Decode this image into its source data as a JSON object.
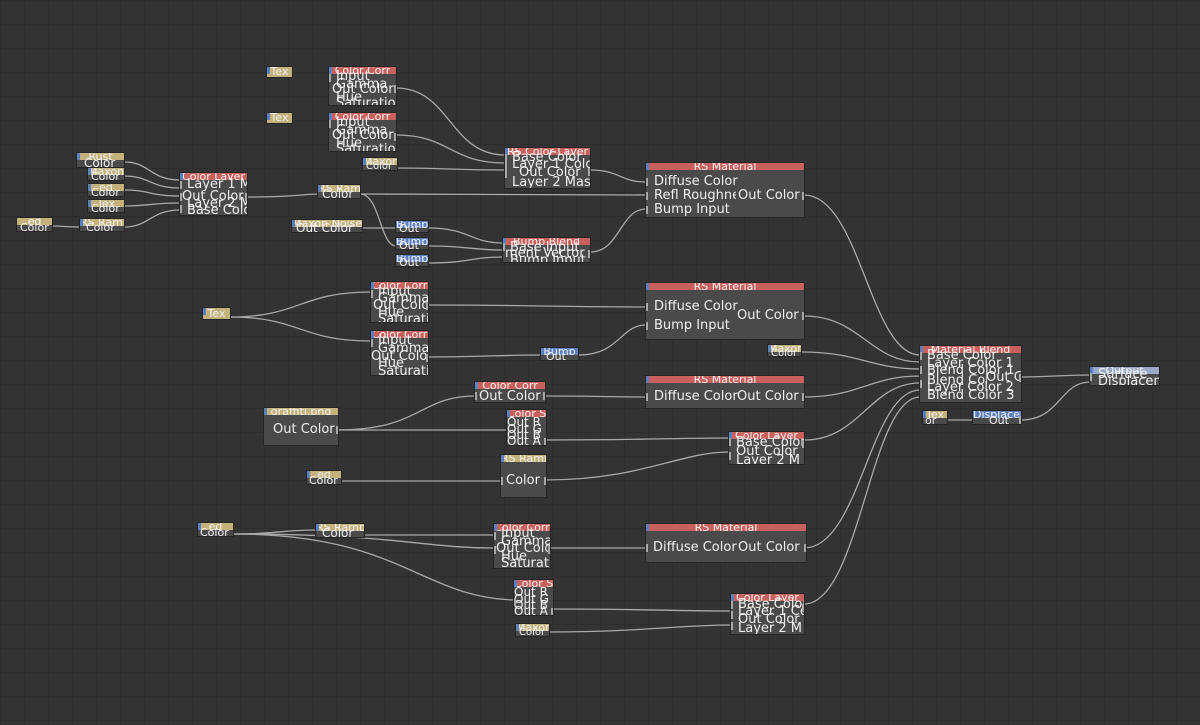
{
  "rs_material_1": {
    "title": "RS Material",
    "in1": "Diffuse Color",
    "in2": "Refl Roughness",
    "in3": "Bump Input",
    "out": "Out Color"
  },
  "rs_material_2": {
    "title": "RS Material",
    "in1": "Diffuse Color",
    "in2": "Bump Input",
    "out": "Out Color"
  },
  "rs_material_3": {
    "title": "RS Material",
    "in1": "Diffuse Color",
    "out": "Out Color"
  },
  "rs_material_4": {
    "title": "RS Material",
    "in1": "Diffuse Color",
    "out": "Out Color"
  },
  "material_blend": {
    "title": "Material Blend",
    "p1": "Base Color",
    "p2": "Layer Color 1",
    "p3": "Blend Color 1",
    "p4": "Blend Color 2",
    "p5": "Blend Color 3",
    "p6": "Layer Color 2",
    "p7": "Layer Color 3",
    "out": "Out Color"
  },
  "output": {
    "title": "Output",
    "p1": "Surface",
    "p2": "Displacement"
  },
  "cc1": {
    "title": "Color Corr",
    "p1": "Input",
    "p2": "Gamma",
    "p3": "Out Color",
    "p4": "Hue",
    "p5": "Saturation"
  },
  "cc2": {
    "title": "Color Corr",
    "p1": "Input",
    "p2": "Gamma",
    "p3": "Out Color",
    "p4": "Hue",
    "p5": "Saturation"
  },
  "cc3": {
    "title": "Color Corr",
    "p1": "Input",
    "p2": "Gamma",
    "p3": "Out Color",
    "p4": "Hue",
    "p5": "Saturation"
  },
  "cc4": {
    "title": "Color Corr",
    "p1": "Input",
    "p2": "Gamma",
    "p3": "Out Color",
    "p4": "Hue",
    "p5": "Saturation"
  },
  "cc5": {
    "title": "Color Corr",
    "p1": "Input",
    "p2": "Gamma",
    "p3": "Out Color",
    "p4": "Hue",
    "p5": "Saturation"
  },
  "cc6": {
    "title": "Color Corr",
    "p1": "Out Color"
  },
  "cl1": {
    "title": "RS Color Layer",
    "p1": "Base Color",
    "p2": "Layer 1 Color",
    "p3": "Out Color",
    "p4": "Layer 2 Mask"
  },
  "cl2": {
    "title": "Color Layer",
    "p1": "Layer 1 M",
    "p2": "Out Color",
    "p3": "Layer 2 M",
    "p4": "Base Color"
  },
  "cl3": {
    "title": "Color Layer",
    "p1": "Base Color",
    "p2": "Out Color",
    "p3": "Layer 2 M"
  },
  "cl4": {
    "title": "Color Layer",
    "p1": "Base Color",
    "p2": "Layer 1 Co",
    "p3": "Out Color",
    "p4": "Layer 2 M"
  },
  "bump_blend": {
    "title": "Bump Blend",
    "p1": "Base Input",
    "p2": "ment Vector",
    "p3": "Bump Input"
  },
  "bump1": {
    "title": "Bump",
    "out": "Out"
  },
  "bump2": {
    "title": "Bump",
    "out": "Out"
  },
  "bump3": {
    "title": "Bump",
    "out": "Out"
  },
  "bump4": {
    "title": "Bump",
    "out": "Out"
  },
  "ramp1": {
    "title": "RS Ramp",
    "out": "Color"
  },
  "ramp2": {
    "title": "RS Ramp",
    "out": "Color"
  },
  "ramp3": {
    "title": "RS Ramp",
    "out": "Color"
  },
  "ramp4": {
    "title": "RS Ramp",
    "out": "Color"
  },
  "maxon_noise": {
    "title": "Maxon Noise",
    "out": "Out Color"
  },
  "tex1": {
    "title": "Tex"
  },
  "tex2": {
    "title": "Tex"
  },
  "tex3": {
    "title": "Tex"
  },
  "tex4": {
    "title": "Tex"
  },
  "rust_tex": {
    "title": "Rust",
    "out": "Color"
  },
  "graffiti_tex": {
    "title": "graffiti.png",
    "out": "Out Color"
  },
  "sep1": {
    "title": "Color Split",
    "p1": "Out R",
    "p2": "Out G",
    "p3": "Out B",
    "p4": "Out A"
  },
  "sep2": {
    "title": "Color Split",
    "p1": "Out R",
    "p2": "Out G",
    "p3": "Out B",
    "p4": "Out A"
  },
  "disp": {
    "title": "Displacement",
    "out": "Out"
  },
  "maxon_small": {
    "title": "Maxon",
    "out": "Color"
  },
  "misc_col": {
    "title": "",
    "out": "Color"
  },
  "misc_out": {
    "title": "",
    "out": "Out"
  },
  "misc_or": {
    "title": "",
    "out": "or"
  },
  "misc_xon": {
    "title": "Maxon",
    "out": "Color"
  },
  "misc_ed": {
    "title": "ed",
    "out": "Color"
  }
}
